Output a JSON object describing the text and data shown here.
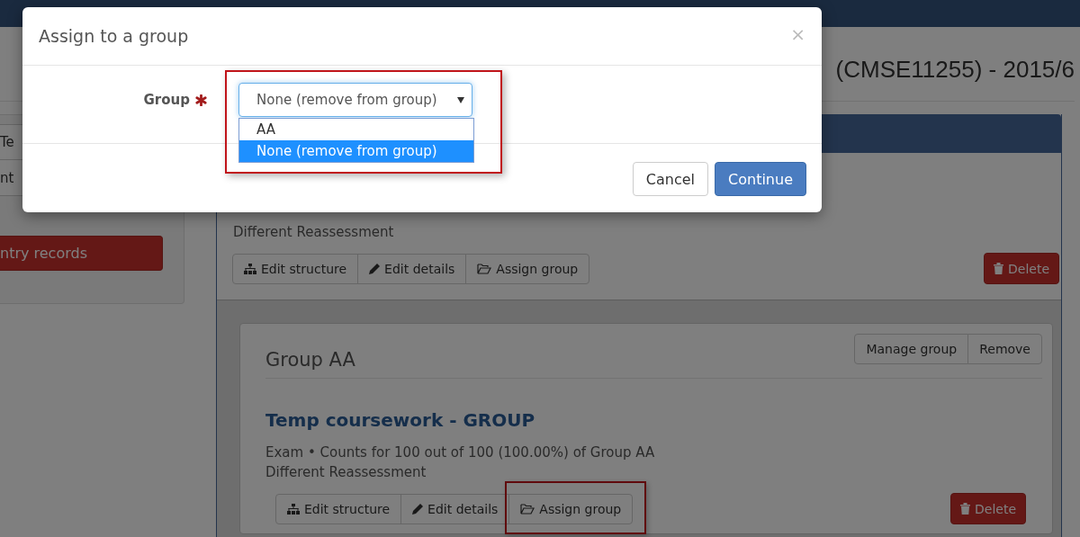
{
  "page_title": {
    "end": "(CMSE11255) - 2015/6"
  },
  "sidebar": {
    "items": [
      {
        "label": "Te"
      },
      {
        "label": "nt"
      }
    ],
    "action_button": "ntry records"
  },
  "assessment": {
    "note": "Different Reassessment",
    "actions": [
      {
        "label": "Edit structure",
        "highlighted": false
      },
      {
        "label": "Edit details",
        "highlighted": false
      },
      {
        "label": "Assign group",
        "highlighted": false
      }
    ],
    "delete": "Delete"
  },
  "group": {
    "title": "Group AA",
    "buttons": [
      "Manage group",
      "Remove"
    ],
    "assessment": {
      "title": "Temp coursework - GROUP",
      "meta": "Exam • Counts for 100 out of 100 (100.00%) of Group AA",
      "note": "Different Reassessment",
      "actions": [
        {
          "label": "Edit structure",
          "highlighted": false
        },
        {
          "label": "Edit details",
          "highlighted": false
        },
        {
          "label": "Assign group",
          "highlighted": true
        }
      ],
      "delete": "Delete"
    }
  },
  "modal": {
    "title": "Assign to a group",
    "close": "×",
    "field": {
      "label": "Group",
      "required": true,
      "value": "None (remove from group)",
      "expanded": true,
      "highlighted": true,
      "options": [
        {
          "label": "AA",
          "selected": false
        },
        {
          "label": "None (remove from group)",
          "selected": true
        }
      ]
    },
    "buttons": [
      {
        "label": "Cancel",
        "kind": "default"
      },
      {
        "label": "Continue",
        "kind": "primary"
      }
    ]
  }
}
